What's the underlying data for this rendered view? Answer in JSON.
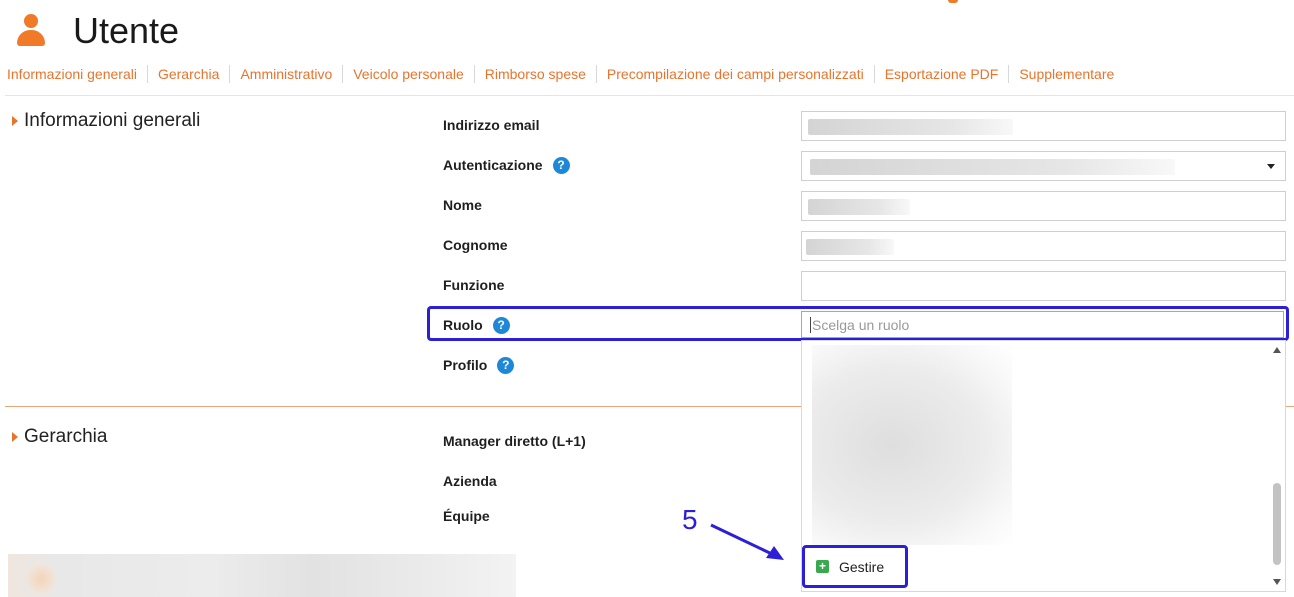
{
  "header": {
    "title": "Utente",
    "icon": "user-icon",
    "accent_color": "#e8742c"
  },
  "tabs": [
    {
      "label": "Informazioni generali"
    },
    {
      "label": "Gerarchia"
    },
    {
      "label": "Amministrativo"
    },
    {
      "label": "Veicolo personale"
    },
    {
      "label": "Rimborso spese"
    },
    {
      "label": "Precompilazione dei campi personalizzati"
    },
    {
      "label": "Esportazione PDF"
    },
    {
      "label": "Supplementare"
    }
  ],
  "general_section": {
    "title": "Informazioni generali",
    "fields": {
      "email": {
        "label": "Indirizzo email"
      },
      "authentication": {
        "label": "Autenticazione"
      },
      "first_name": {
        "label": "Nome"
      },
      "last_name": {
        "label": "Cognome"
      },
      "function": {
        "label": "Funzione"
      },
      "role": {
        "label": "Ruolo",
        "placeholder": "Scelga un ruolo"
      },
      "profile": {
        "label": "Profilo"
      }
    }
  },
  "role_dropdown": {
    "manage_label": "Gestire"
  },
  "hierarchy_section": {
    "title": "Gerarchia",
    "fields": {
      "direct_manager": {
        "label": "Manager diretto (L+1)"
      },
      "company": {
        "label": "Azienda"
      },
      "team": {
        "label": "Équipe"
      }
    }
  },
  "annotation": {
    "step": "5",
    "highlight_color": "#2b1fd8"
  }
}
